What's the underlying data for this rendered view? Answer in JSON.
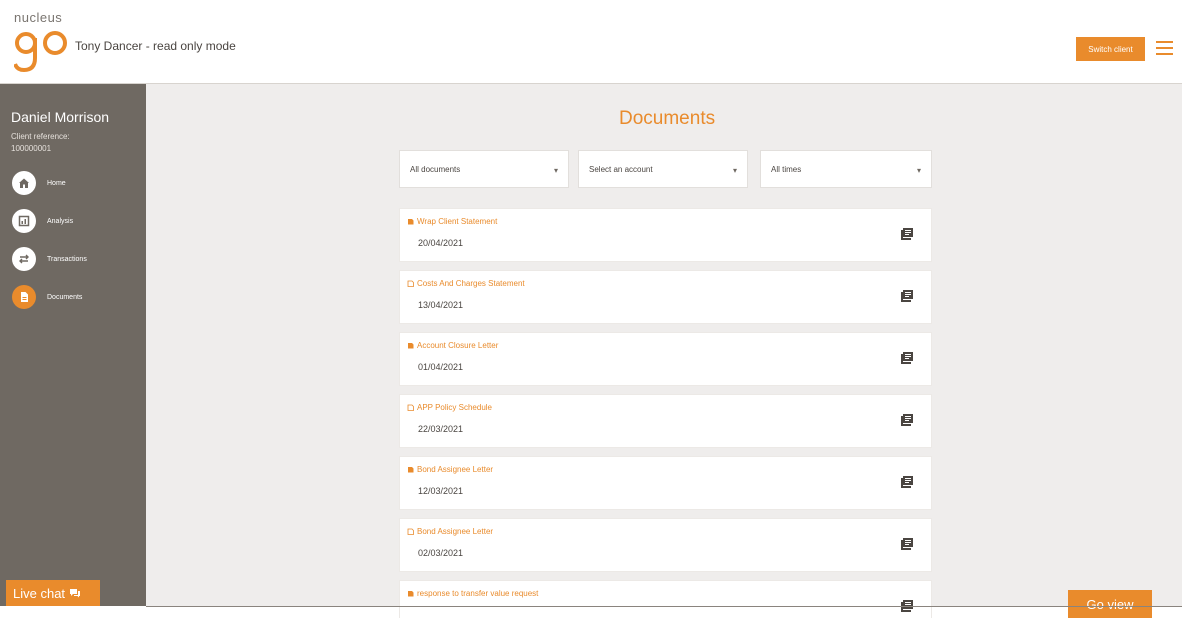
{
  "header": {
    "logo_small": "nucleus",
    "read_only_text": "Tony Dancer - read only mode",
    "switch_button": "Switch client",
    "menu_icon": "hamburger-menu-icon"
  },
  "sidebar": {
    "client_name": "Daniel Morrison",
    "client_ref_label": "Client reference:",
    "client_ref": "100000001",
    "items": [
      {
        "label": "Home",
        "icon": "home-icon",
        "active": false
      },
      {
        "label": "Analysis",
        "icon": "chart-icon",
        "active": false
      },
      {
        "label": "Transactions",
        "icon": "transfer-icon",
        "active": false
      },
      {
        "label": "Documents",
        "icon": "document-icon",
        "active": true
      }
    ],
    "live_chat": "Live chat"
  },
  "main": {
    "title": "Documents",
    "filters": [
      {
        "value": "All documents"
      },
      {
        "value": "Select an account"
      },
      {
        "value": "All times"
      }
    ],
    "documents": [
      {
        "title": "Wrap Client Statement",
        "date": "20/04/2021",
        "unread": true
      },
      {
        "title": "Costs And Charges Statement",
        "date": "13/04/2021",
        "unread": false
      },
      {
        "title": "Account Closure Letter",
        "date": "01/04/2021",
        "unread": true
      },
      {
        "title": "APP Policy Schedule",
        "date": "22/03/2021",
        "unread": false
      },
      {
        "title": "Bond Assignee Letter",
        "date": "12/03/2021",
        "unread": true
      },
      {
        "title": "Bond Assignee Letter",
        "date": "02/03/2021",
        "unread": false
      },
      {
        "title": "response to transfer value request",
        "date": "",
        "unread": true
      }
    ]
  },
  "go_view": "Go view",
  "colors": {
    "accent": "#e98b2c",
    "sidebar_bg": "#6f6962",
    "main_bg": "#efedec"
  }
}
